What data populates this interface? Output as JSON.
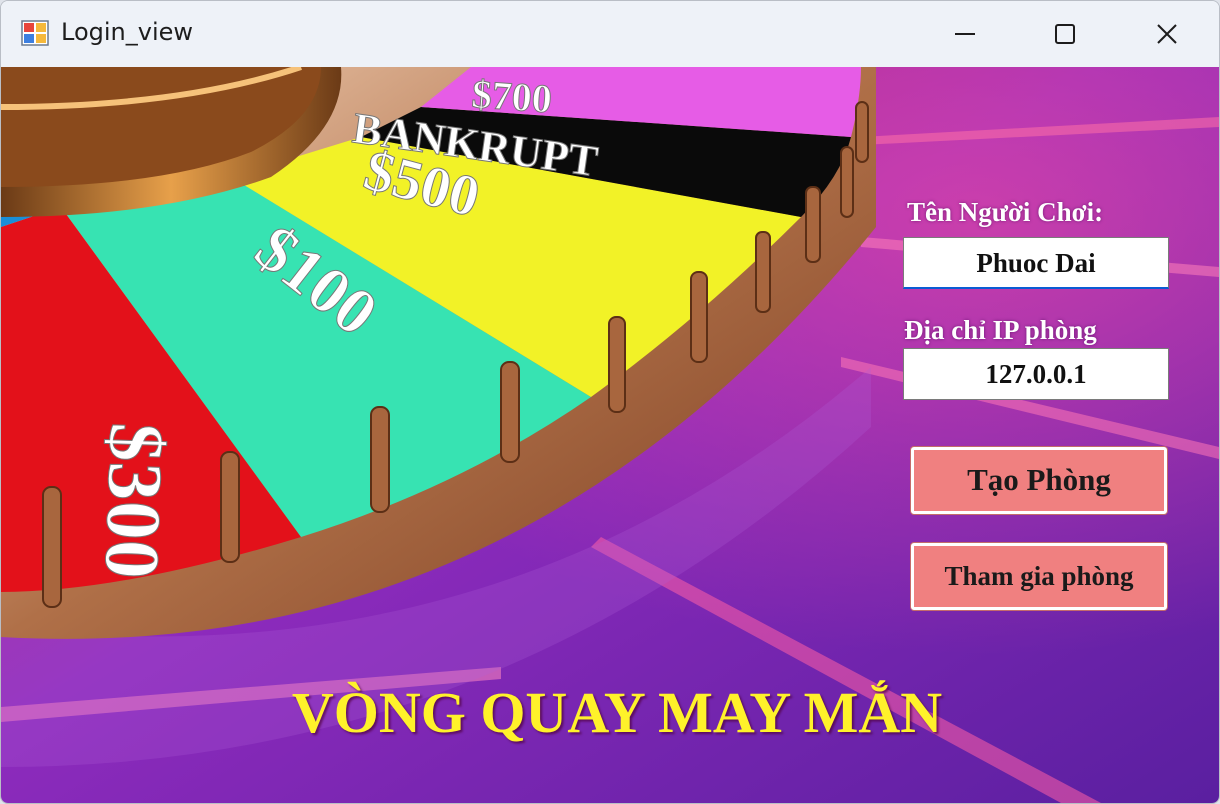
{
  "window": {
    "title": "Login_view",
    "controls": {
      "minimize": "minimize-icon",
      "maximize": "maximize-icon",
      "close": "close-icon"
    }
  },
  "wheel": {
    "segments": [
      "$300",
      "$100",
      "$500",
      "BANKRUPT",
      "$700"
    ]
  },
  "form": {
    "player_name_label": "Tên Người Chơi:",
    "player_name_value": "Phuoc Dai",
    "room_ip_label": "Địa chỉ IP phòng",
    "room_ip_value": "127.0.0.1"
  },
  "buttons": {
    "create_room": "Tạo Phòng",
    "join_room": "Tham gia phòng"
  },
  "game_title": "VÒNG QUAY MAY MẮN",
  "colors": {
    "background": "#8a2bb0",
    "button": "#f08080",
    "title_text": "#fff22a"
  }
}
